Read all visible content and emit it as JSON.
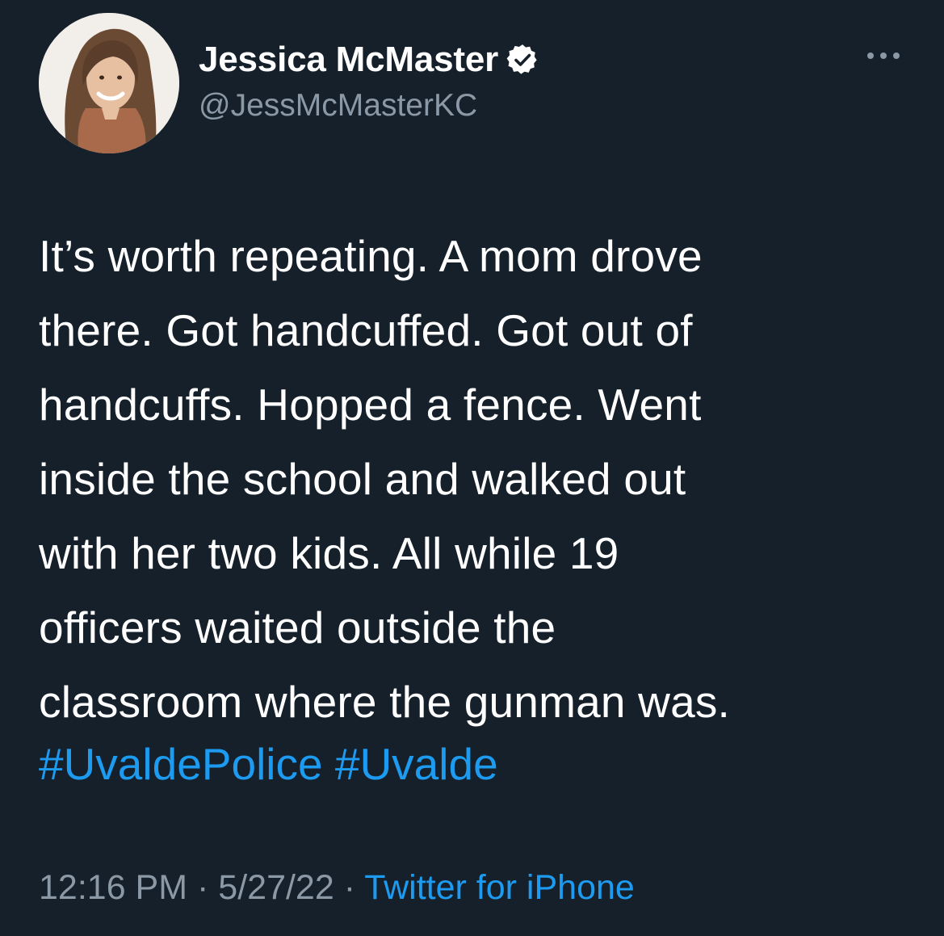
{
  "author": {
    "display_name": "Jessica McMaster",
    "handle": "@JessMcMasterKC",
    "verified": true,
    "avatar_icon": "profile-photo"
  },
  "tweet": {
    "text": "It’s worth repeating. A mom drove\nthere. Got handcuffed. Got out of\nhandcuffs. Hopped a fence. Went\ninside the school and walked out\nwith her two kids. All while 19\nofficers waited outside the\nclassroom where the gunman was.",
    "hashtags": [
      "#UvaldePolice",
      "#Uvalde"
    ],
    "time": "12:16 PM",
    "date": "5/27/22",
    "separator": "·",
    "source": "Twitter for iPhone"
  },
  "menu": {
    "more_icon": "more-horizontal-icon"
  },
  "colors": {
    "background": "#15202b",
    "text": "#ffffff",
    "secondary": "#8b98a5",
    "accent": "#1d9bf0"
  }
}
